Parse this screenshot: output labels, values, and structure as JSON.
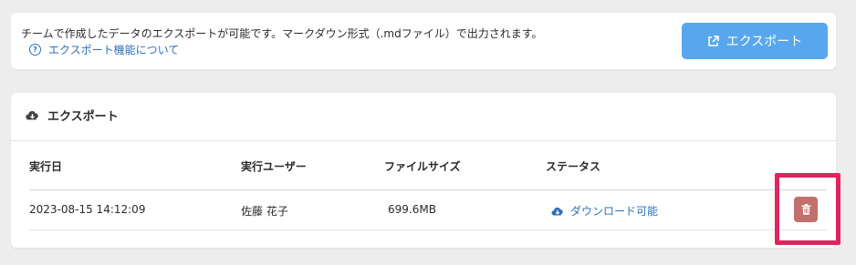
{
  "info_panel": {
    "description": "チームで作成したデータのエクスポートが可能です。マークダウン形式（.mdファイル）で出力されます。",
    "help_link": "エクスポート機能について",
    "export_button": "エクスポート"
  },
  "export_section": {
    "title": "エクスポート",
    "columns": [
      "実行日",
      "実行ユーザー",
      "ファイルサイズ",
      "ステータス"
    ],
    "rows": [
      {
        "date": "2023-08-15 14:12:09",
        "user": "佐藤 花子",
        "size": "699.6MB",
        "status": "ダウンロード可能"
      }
    ]
  },
  "colors": {
    "accent": "#56a7ee",
    "link": "#2f6fb6",
    "delete": "#c2706b",
    "highlight": "#e0245e"
  },
  "icons": [
    "help-circle-icon",
    "external-link-icon",
    "cloud-download-icon",
    "trash-icon"
  ]
}
